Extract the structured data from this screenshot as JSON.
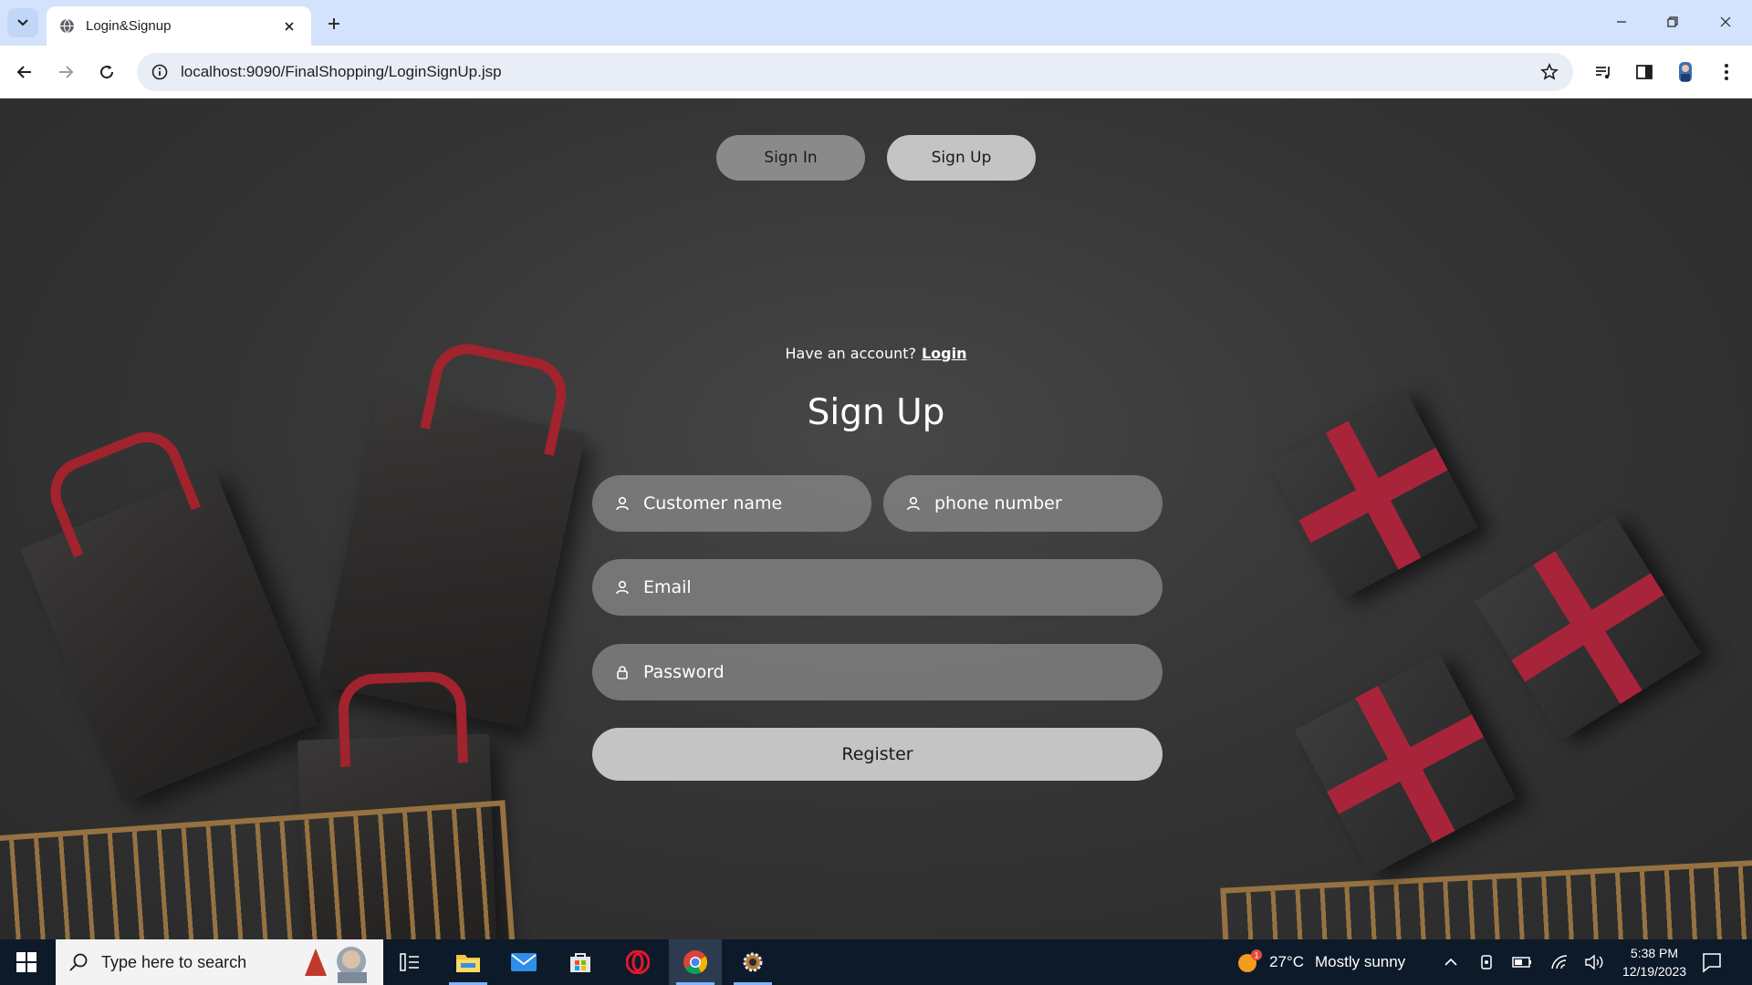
{
  "browser": {
    "tab_title": "Login&Signup",
    "url": "localhost:9090/FinalShopping/LoginSignUp.jsp"
  },
  "page": {
    "switch": {
      "signin_label": "Sign In",
      "signup_label": "Sign Up"
    },
    "have_account_text": "Have an account?",
    "login_link": "Login",
    "title": "Sign Up",
    "fields": {
      "name_placeholder": "Customer name",
      "phone_placeholder": "phone number",
      "email_placeholder": "Email",
      "password_placeholder": "Password"
    },
    "register_label": "Register"
  },
  "taskbar": {
    "search_placeholder": "Type here to search",
    "weather_temp": "27°C",
    "weather_desc": "Mostly sunny",
    "weather_badge": "1",
    "time": "5:38 PM",
    "date": "12/19/2023"
  },
  "colors": {
    "tabstrip": "#d3e3fd",
    "ribbon": "#a8243a",
    "field_bg": "#878787",
    "button_bg": "#c4c4c4",
    "taskbar": "#0d1a2a"
  }
}
